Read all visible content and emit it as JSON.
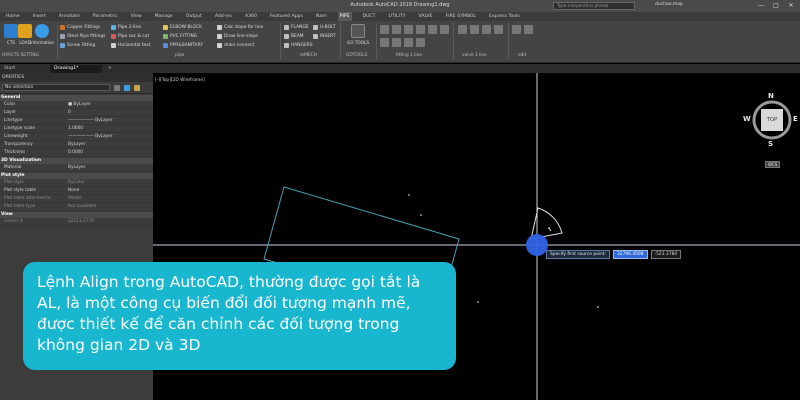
{
  "titlebar": {
    "title": "Autodesk AutoCAD 2018    Drawing1.dwg",
    "search_placeholder": "Type a keyword or phrase",
    "user": "duchao.map",
    "controls": [
      "—",
      "□",
      "✕"
    ]
  },
  "ribbon_tabs": [
    "Home",
    "Insert",
    "Annotate",
    "Parametric",
    "View",
    "Manage",
    "Output",
    "Add-ins",
    "A360",
    "Featured Apps",
    "Nam",
    "PIPE",
    "DUCT",
    "UTILITY",
    "VALVE",
    "FIRE SYMBOL",
    "Express Tools"
  ],
  "ribbon_active_tab": "PIPE",
  "ribbon": {
    "left_buttons": [
      "CTS",
      "LOAD",
      "Information"
    ],
    "left_group_label": "HVACTS SETTING",
    "col1": [
      "Copper Fittings",
      "Steel Pipe fittings",
      "Screw Fitting"
    ],
    "col2": [
      "Pipe 2-line",
      "Pipe sec & cut",
      "Horizontal text"
    ],
    "col3": [
      "ELBOW BLOCK",
      "PVC FITTING",
      "PPR&SANITARY"
    ],
    "col4": [
      "Calc slope for line",
      "Draw line slope",
      "drain connect"
    ],
    "pipe_label": "pipe",
    "col5": [
      "FLANGE",
      "BEAM",
      "HANGERS"
    ],
    "col6": [
      "U-BOLT",
      "INSERT"
    ],
    "mmech_label": "mMECH",
    "gotools_button": "GO TOOLS",
    "gotools_label": "GOTOOLS",
    "fitting_label": "fitting 1 line",
    "valve_label": "valve 1 line",
    "edit_label": "edit"
  },
  "doc_tabs": [
    "Start",
    "Drawing1*",
    "+"
  ],
  "properties": {
    "header": "OPERTIES",
    "selection": "No selection",
    "categories": [
      {
        "name": "General",
        "rows": [
          {
            "k": "Color",
            "v": "■ ByLayer"
          },
          {
            "k": "Layer",
            "v": "0"
          },
          {
            "k": "Linetype",
            "v": "—————— ByLayer"
          },
          {
            "k": "Linetype scale",
            "v": "1.0000"
          },
          {
            "k": "Lineweight",
            "v": "—————— ByLayer"
          },
          {
            "k": "Transparency",
            "v": "ByLayer"
          },
          {
            "k": "Thickness",
            "v": "0.0000"
          }
        ]
      },
      {
        "name": "3D Visualization",
        "rows": [
          {
            "k": "Material",
            "v": "ByLayer"
          }
        ]
      },
      {
        "name": "Plot style",
        "rows": [
          {
            "k": "Plot style",
            "v": "ByColor",
            "grey": true
          },
          {
            "k": "Plot style table",
            "v": "None"
          },
          {
            "k": "Plot table attached to",
            "v": "Model",
            "grey": true
          },
          {
            "k": "Plot table type",
            "v": "Not available",
            "grey": true
          }
        ]
      },
      {
        "name": "View",
        "rows": [
          {
            "k": "Center X",
            "v": "32513.2779",
            "grey": true
          }
        ]
      }
    ]
  },
  "viewport": {
    "label": "[-][Top][2D Wireframe]",
    "viewcube_top": "TOP",
    "compass": {
      "n": "N",
      "s": "S",
      "e": "E",
      "w": "W"
    },
    "wcs": "WCS"
  },
  "dynamic_input": {
    "prompt": "Specify first source point:",
    "field1": "32796.4598",
    "field2": "-523.3784"
  },
  "caption": "Lệnh Align trong AutoCAD, thường được gọi tắt là AL, là một công cụ biến đổi đối tượng mạnh mẽ, được thiết kế để căn chỉnh các đối tượng trong không gian 2D và 3D",
  "colors": {
    "crosshair": "#c9d3e6",
    "cursor_circle": "#2f63e8",
    "caption_bg": "#19b6cf",
    "rectangle": "#4a9fb0"
  }
}
